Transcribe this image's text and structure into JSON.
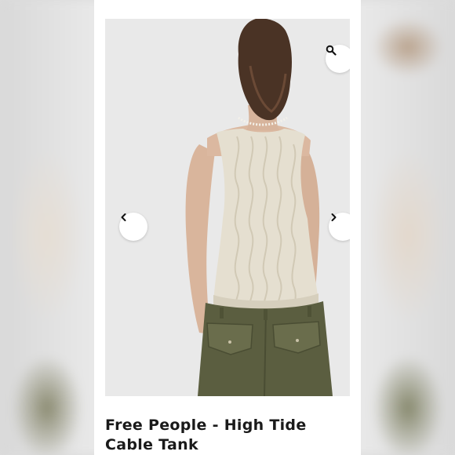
{
  "product": {
    "title": "Free People - High Tide Cable Tank"
  },
  "gallery": {
    "zoom_icon": "magnifier-icon",
    "prev_icon": "chevron-left-icon",
    "next_icon": "chevron-right-icon"
  },
  "colors": {
    "card_background": "#ffffff",
    "photo_background": "#e9e9e9",
    "sweater": "#e5dfd0",
    "pants": "#5b5e40",
    "hair": "#4a3325"
  }
}
